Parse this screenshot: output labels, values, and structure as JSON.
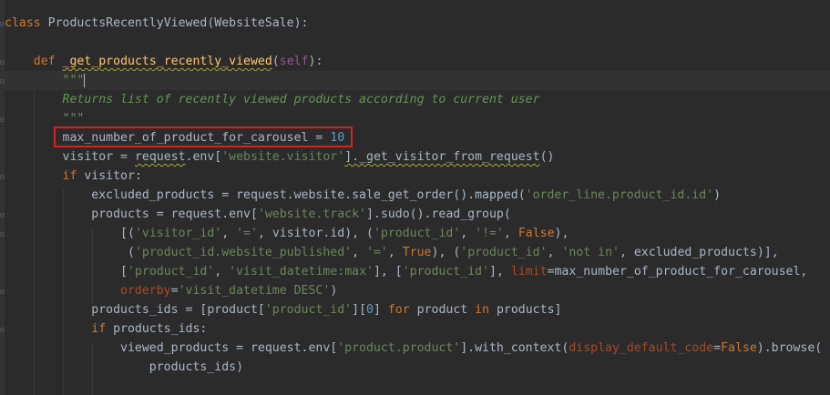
{
  "editor": {
    "language": "python",
    "lines": {
      "l1": {
        "kw": "class",
        "name": "ProductsRecentlyViewed",
        "rest": "(WebsiteSale):"
      },
      "l2": {
        "kw": "def",
        "fn": "_get_products_recently_viewed",
        "open": "(",
        "self": "self",
        "close": "):"
      },
      "l3": {
        "doc": "\"\"\""
      },
      "l4": {
        "doc": "Returns list of recently viewed products according to current user"
      },
      "l5": {
        "doc": "\"\"\""
      },
      "l6": {
        "code": "max_number_of_product_for_carousel = ",
        "num": "10"
      },
      "l7": {
        "a": "visitor = ",
        "b": "request",
        "c": ".env[",
        "s": "'website.visitor'",
        "d": "]._get_visitor_from_request",
        "e": "()"
      },
      "l8": {
        "kw": "if",
        "rest": " visitor:"
      },
      "l9": {
        "a": "excluded_products = request.website.sale_get_order().mapped(",
        "s": "'order_line.product_id.id'",
        "b": ")"
      },
      "l10": {
        "a": "products = request.env[",
        "s": "'website.track'",
        "b": "].sudo().read_group("
      },
      "l11": {
        "a": "[(",
        "s1": "'visitor_id'",
        "b": ", ",
        "s2": "'='",
        "c": ", visitor.id), (",
        "s3": "'product_id'",
        "d": ", ",
        "s4": "'!='",
        "e": ", ",
        "k": "False",
        "f": "),"
      },
      "l12": {
        "a": " (",
        "s1": "'product_id.website_published'",
        "b": ", ",
        "s2": "'='",
        "c": ", ",
        "k": "True",
        "d": "), (",
        "s3": "'product_id'",
        "e": ", ",
        "s4": "'not in'",
        "f": ", excluded_products)],"
      },
      "l13": {
        "a": "[",
        "s1": "'product_id'",
        "b": ", ",
        "s2": "'visit_datetime:max'",
        "c": "], [",
        "s3": "'product_id'",
        "d": "], ",
        "p": "limit",
        "e": "=max_number_of_product_for_carousel,"
      },
      "l14": {
        "p": "orderby",
        "a": "=",
        "s": "'visit_datetime DESC'",
        "b": ")"
      },
      "l15": {
        "a": "products_ids = [product[",
        "s": "'product_id'",
        "b": "][",
        "n": "0",
        "c": "] ",
        "k1": "for",
        "d": " product ",
        "k2": "in",
        "e": " products]"
      },
      "l16": {
        "kw": "if",
        "rest": " products_ids:"
      },
      "l17": {
        "a": "viewed_products = request.env[",
        "s": "'product.product'",
        "b": "].with_context(",
        "p": "display_default_code",
        "c": "=",
        "k": "False",
        "d": ").browse("
      },
      "l18": {
        "a": "products_ids)"
      }
    }
  }
}
